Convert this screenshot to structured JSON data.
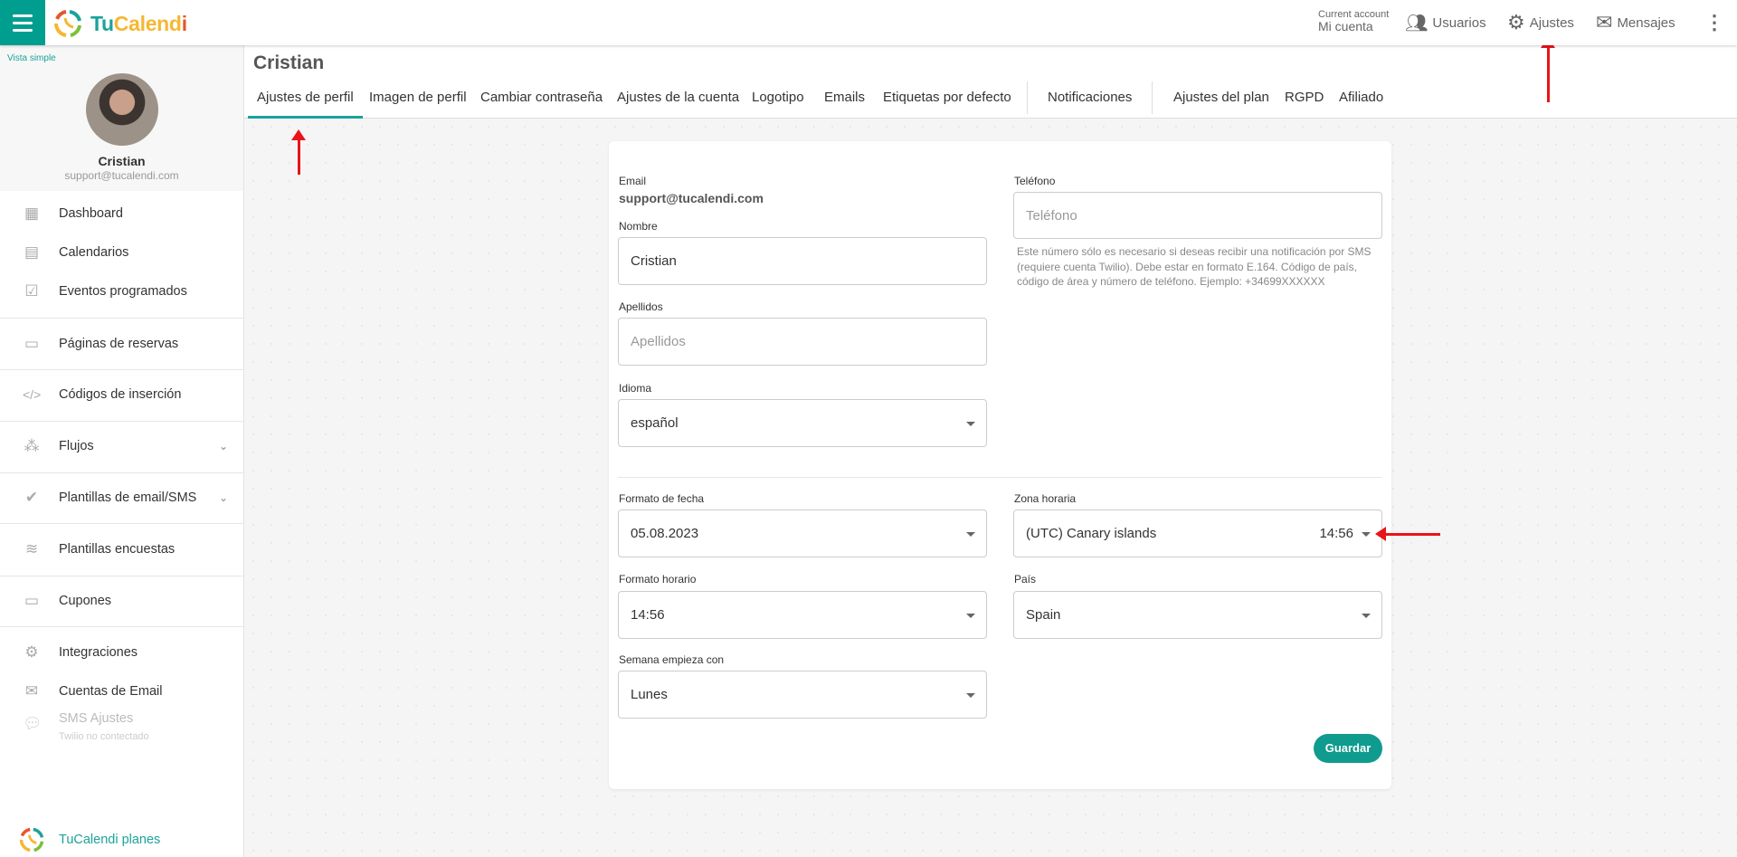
{
  "app": {
    "logo_parts": [
      "Tu",
      "Calend",
      "i"
    ]
  },
  "topnav": {
    "account_caption": "Current account",
    "account_name": "Mi cuenta",
    "users": "Usuarios",
    "settings": "Ajustes",
    "messages": "Mensajes"
  },
  "sidebar": {
    "simple_view": "Vista simple",
    "user_name": "Cristian",
    "user_email": "support@tucalendi.com",
    "items": [
      {
        "label": "Dashboard",
        "icon": "grid-icon"
      },
      {
        "label": "Calendarios",
        "icon": "calendar-icon"
      },
      {
        "label": "Eventos programados",
        "icon": "calendar-check-icon"
      },
      {
        "label": "Páginas de reservas",
        "icon": "browser-icon"
      },
      {
        "label": "Códigos de inserción",
        "icon": "code-icon"
      },
      {
        "label": "Flujos",
        "icon": "flow-icon"
      },
      {
        "label": "Plantillas de email/SMS",
        "icon": "check-double-icon"
      },
      {
        "label": "Plantillas encuestas",
        "icon": "layers-icon"
      },
      {
        "label": "Cupones",
        "icon": "ticket-icon"
      },
      {
        "label": "Integraciones",
        "icon": "gears-icon"
      },
      {
        "label": "Cuentas de Email",
        "icon": "envelope-icon"
      },
      {
        "label": "SMS Ajustes",
        "sub": "Twilio no contectado",
        "icon": "sms-icon"
      }
    ],
    "plans": "TuCalendi planes"
  },
  "page": {
    "title": "Cristian",
    "tabs": [
      "Ajustes de perfil",
      "Imagen de perfil",
      "Cambiar contraseña",
      "Ajustes de la cuenta",
      "Logotipo",
      "Emails",
      "Etiquetas por defecto",
      "Notificaciones",
      "Ajustes del plan",
      "RGPD",
      "Afiliado"
    ],
    "active_tab": "Ajustes de perfil"
  },
  "form": {
    "email_label": "Email",
    "email_value": "support@tucalendi.com",
    "name_label": "Nombre",
    "name_value": "Cristian",
    "surname_label": "Apellidos",
    "surname_placeholder": "Apellidos",
    "language_label": "Idioma",
    "language_value": "español",
    "phone_label": "Teléfono",
    "phone_placeholder": "Teléfono",
    "phone_help": "Este número sólo es necesario si deseas recibir una notificación por SMS (requiere cuenta Twilio). Debe estar en formato E.164. Código de país, código de área y número de teléfono. Ejemplo: +34699XXXXXX",
    "date_format_label": "Formato de fecha",
    "date_format_value": "05.08.2023",
    "timezone_label": "Zona horaria",
    "timezone_value": "(UTC) Canary islands",
    "timezone_time": "14:56",
    "time_format_label": "Formato horario",
    "time_format_value": "14:56",
    "country_label": "País",
    "country_value": "Spain",
    "week_start_label": "Semana empieza con",
    "week_start_value": "Lunes",
    "save": "Guardar"
  },
  "colors": {
    "accent": "#009e8e",
    "annotation": "#e8141a"
  }
}
